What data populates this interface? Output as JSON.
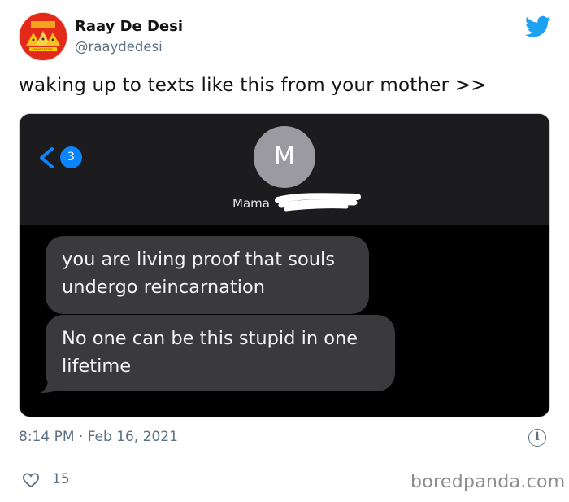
{
  "tweet": {
    "author_name": "Raay De Desi",
    "author_handle": "@raaydedesi",
    "avatar_text": "RAAY DE DESI",
    "text": "waking up to texts like this from your mother >>",
    "timestamp": "8:14 PM · Feb 16, 2021",
    "like_count": "15",
    "twitter_icon": "twitter-bird-icon",
    "info_icon": "info-icon",
    "like_icon": "heart-icon"
  },
  "screenshot": {
    "back_badge": "3",
    "contact_initial": "M",
    "contact_name": "Mama",
    "messages": [
      {
        "text": "you are living proof that souls undergo reincarnation"
      },
      {
        "text": "No one can be this stupid in one lifetime"
      }
    ]
  },
  "watermark": "boredpanda.com",
  "colors": {
    "twitter_blue": "#1da1f2",
    "ios_blue": "#0a84ff",
    "bubble_gray": "#3a3a3c",
    "avatar_red": "#e32a1a"
  }
}
